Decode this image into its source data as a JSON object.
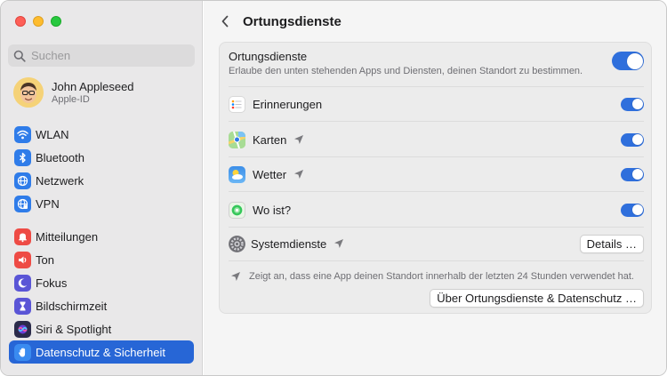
{
  "sidebar": {
    "search_placeholder": "Suchen",
    "user": {
      "name": "John Appleseed",
      "subtitle": "Apple-ID"
    },
    "group1": [
      {
        "label": "WLAN",
        "icon": "wifi-icon",
        "color": "#2f7ce9"
      },
      {
        "label": "Bluetooth",
        "icon": "bluetooth-icon",
        "color": "#2f7ce9"
      },
      {
        "label": "Netzwerk",
        "icon": "globe-icon",
        "color": "#2f7ce9"
      },
      {
        "label": "VPN",
        "icon": "vpn-globe-icon",
        "color": "#2f7ce9"
      }
    ],
    "group2": [
      {
        "label": "Mitteilungen",
        "icon": "bell-icon",
        "color": "#ee4b45"
      },
      {
        "label": "Ton",
        "icon": "speaker-icon",
        "color": "#ee4b45"
      },
      {
        "label": "Fokus",
        "icon": "moon-icon",
        "color": "#5a55d6"
      },
      {
        "label": "Bildschirmzeit",
        "icon": "hourglass-icon",
        "color": "#5a55d6"
      },
      {
        "label": "Siri & Spotlight",
        "icon": "siri-icon",
        "color": "#2b2b4a"
      },
      {
        "label": "Datenschutz & Sicherheit",
        "icon": "hand-icon",
        "color": "#2f7ce9",
        "selected": true
      }
    ]
  },
  "main": {
    "title": "Ortungsdienste",
    "location_services": {
      "title": "Ortungsdienste",
      "description": "Erlaube den unten stehenden Apps und Diensten, deinen Standort zu bestimmen.",
      "enabled": true
    },
    "apps": [
      {
        "label": "Erinnerungen",
        "icon": "reminders-icon",
        "recent": false,
        "enabled": true
      },
      {
        "label": "Karten",
        "icon": "maps-icon",
        "recent": true,
        "enabled": true
      },
      {
        "label": "Wetter",
        "icon": "weather-icon",
        "recent": true,
        "enabled": true
      },
      {
        "label": "Wo ist?",
        "icon": "find-my-icon",
        "recent": false,
        "enabled": true
      }
    ],
    "system_services": {
      "label": "Systemdienste",
      "button": "Details …"
    },
    "footnote": "Zeigt an, dass eine App deinen Standort innerhalb der letzten 24 Stunden verwendet hat.",
    "about_button": "Über Ortungsdienste & Datenschutz …"
  },
  "colors": {
    "accent": "#2766d6",
    "toggle": "#2f6fdc"
  }
}
